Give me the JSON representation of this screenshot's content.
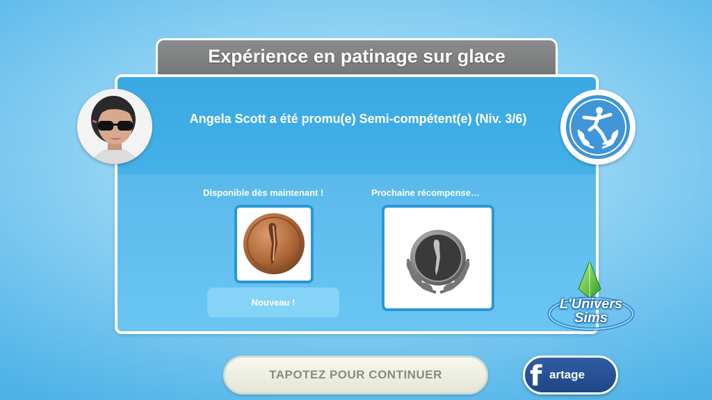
{
  "dialog": {
    "title": "Expérience en patinage sur glace",
    "promotion_text": "Angela Scott a été promu(e) Semi-compétent(e) (Niv. 3/6)"
  },
  "rewards": {
    "available_label": "Disponible dès maintenant !",
    "next_label": "Prochaine récompense…",
    "new_badge": "Nouveau !",
    "current_medal_icon": "bronze-skater-medal",
    "next_medal_icon": "silver-skater-medal"
  },
  "actions": {
    "continue_label": "TAPOTEZ POUR CONTINUER",
    "share_label": "Partage",
    "share_display": "artage",
    "share_icon": "facebook-f"
  },
  "logo": {
    "line1": "L'Univers",
    "line2": "Sims"
  },
  "colors": {
    "panel_blue": "#44b1e8",
    "title_gray": "#7a7c7d",
    "facebook_blue": "#2f5da3",
    "bronze": "#b06a3a",
    "silver": "#8c8c8c"
  }
}
